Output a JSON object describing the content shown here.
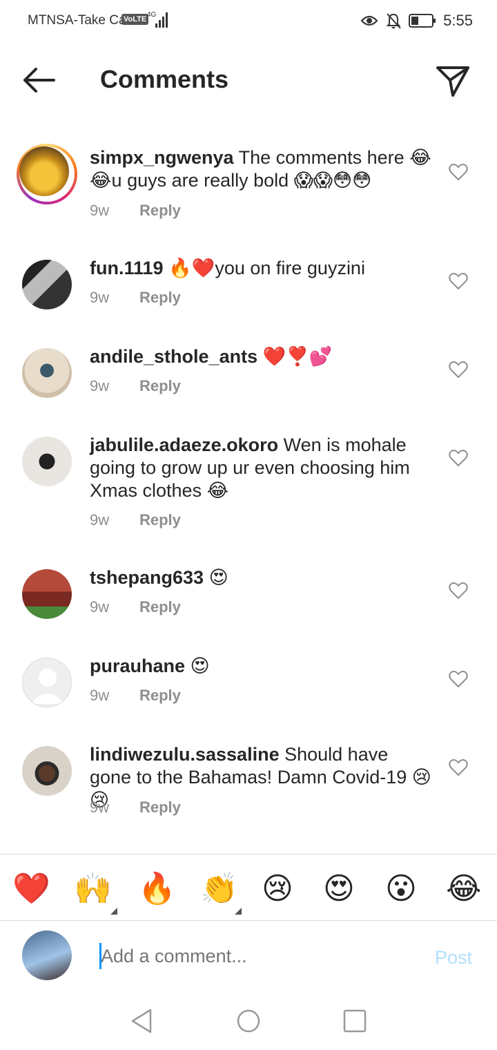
{
  "status_bar": {
    "carrier": "MTNSA-Take Ca",
    "volte": "VoLTE",
    "network": "4G",
    "time": "5:55"
  },
  "header": {
    "title": "Comments"
  },
  "comments": [
    {
      "username": "simpx_ngwenya",
      "text": "The comments here 😂😂u guys are really bold 😱😱😳😳",
      "time": "9w",
      "reply": "Reply"
    },
    {
      "username": "fun.1119",
      "text": "🔥❤️you on fire guyzini",
      "time": "9w",
      "reply": "Reply"
    },
    {
      "username": "andile_sthole_ants",
      "text": "❤️❣️💕",
      "time": "9w",
      "reply": "Reply"
    },
    {
      "username": "jabulile.adaeze.okoro",
      "text": "Wen is mohale going to grow up ur even choosing him Xmas clothes 😂",
      "time": "9w",
      "reply": "Reply"
    },
    {
      "username": "tshepang633",
      "text": "😍",
      "time": "9w",
      "reply": "Reply"
    },
    {
      "username": "purauhane",
      "text": "😍",
      "time": "9w",
      "reply": "Reply"
    },
    {
      "username": "lindiwezulu.sassaline",
      "text": "Should have gone to the Bahamas! Damn Covid-19 😢😢",
      "time": "9w",
      "reply": "Reply"
    }
  ],
  "emoji_bar": [
    "❤️",
    "🙌",
    "🔥",
    "👏",
    "😢",
    "😍",
    "😮",
    "😂"
  ],
  "input": {
    "placeholder": "Add a comment...",
    "post_label": "Post"
  },
  "colors": {
    "accent": "#0095f6",
    "post_disabled": "#b2dffc",
    "muted": "#8e8e8e"
  }
}
